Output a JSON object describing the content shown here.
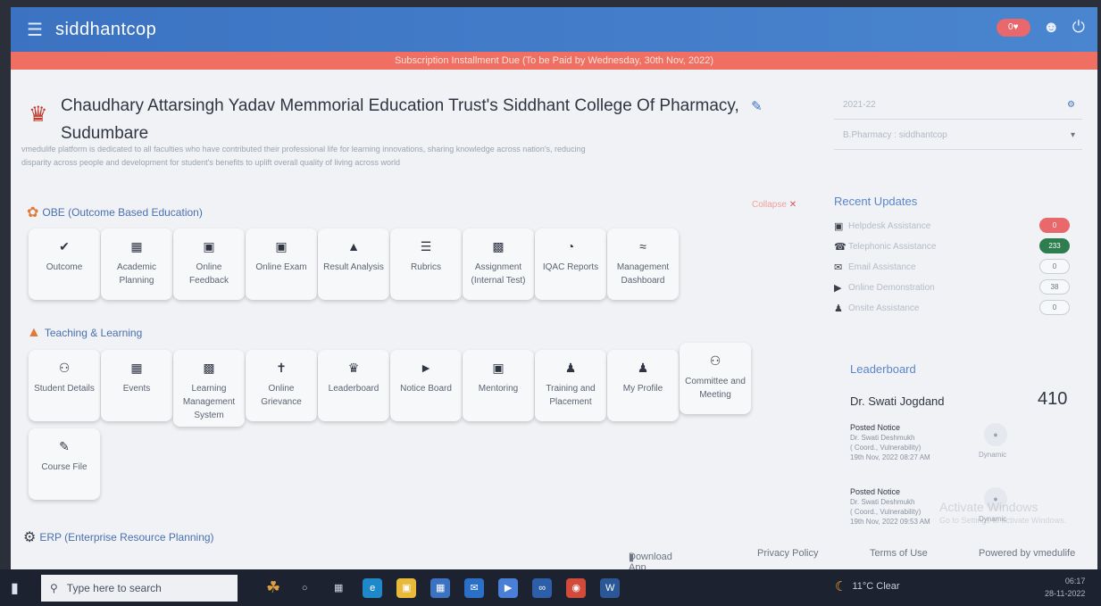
{
  "header": {
    "brand": "siddhantcop",
    "menu_icon": "hamburger-icon",
    "notification_count": "0",
    "banner": "Subscription Installment Due (To be Paid by Wednesday, 30th Nov, 2022)"
  },
  "college": {
    "name_line1": "Chaudhary Attarsingh Yadav Memmorial Education Trust's Siddhant College Of Pharmacy,",
    "name_line2": "Sudumbare",
    "description_line1": "vmedulife platform is dedicated to all faculties who have contributed their professional life for learning innovations, sharing knowledge across nation's, reducing",
    "description_line2": "disparity across people and development for student's benefits to uplift overall quality of living across world"
  },
  "selectors": {
    "year": "2021-22",
    "program": "B.Pharmacy : siddhantcop"
  },
  "obe": {
    "title": "OBE (Outcome Based Education)",
    "collapse_label": "Collapse",
    "tiles": [
      {
        "icon": "thumbs-up-icon",
        "label": "Outcome"
      },
      {
        "icon": "calendar-icon",
        "label": "Academic Planning"
      },
      {
        "icon": "comment-icon",
        "label": "Online Feedback"
      },
      {
        "icon": "folder-icon",
        "label": "Online Exam"
      },
      {
        "icon": "area-chart-icon",
        "label": "Result Analysis"
      },
      {
        "icon": "list-icon",
        "label": "Rubrics"
      },
      {
        "icon": "book-icon",
        "label": "Assignment (Internal Test)"
      },
      {
        "icon": "pie-chart-icon",
        "label": "IQAC Reports"
      },
      {
        "icon": "line-chart-icon",
        "label": "Management Dashboard"
      }
    ]
  },
  "teaching": {
    "title": "Teaching & Learning",
    "tiles": [
      {
        "icon": "users-icon",
        "label": "Student Details"
      },
      {
        "icon": "calendar-icon",
        "label": "Events"
      },
      {
        "icon": "book-icon",
        "label": "Learning Management System"
      },
      {
        "icon": "person-icon",
        "label": "Online Grievance"
      },
      {
        "icon": "trophy-icon",
        "label": "Leaderboard"
      },
      {
        "icon": "megaphone-icon",
        "label": "Notice Board"
      },
      {
        "icon": "presentation-icon",
        "label": "Mentoring"
      },
      {
        "icon": "user-tie-icon",
        "label": "Training and Placement"
      },
      {
        "icon": "user-icon",
        "label": "My Profile"
      },
      {
        "icon": "group-icon",
        "label": "Committee and Meeting"
      },
      {
        "icon": "file-icon",
        "label": "Course File"
      }
    ]
  },
  "erp": {
    "title": "ERP (Enterprise Resource Planning)"
  },
  "recent_updates": {
    "title": "Recent Updates",
    "items": [
      {
        "icon": "desktop-icon",
        "label": "Helpdesk Assistance",
        "count": "0",
        "color": "#e8686b"
      },
      {
        "icon": "phone-icon",
        "label": "Telephonic Assistance",
        "count": "233",
        "color": "#2e7d4f"
      },
      {
        "icon": "envelope-icon",
        "label": "Email Assistance",
        "count": "0",
        "color": ""
      },
      {
        "icon": "video-icon",
        "label": "Online Demonstration",
        "count": "38",
        "color": ""
      },
      {
        "icon": "user-onsite-icon",
        "label": "Onsite Assistance",
        "count": "0",
        "color": ""
      }
    ]
  },
  "leaderboard": {
    "title": "Leaderboard",
    "top_name": "Dr. Swati Jogdand",
    "top_score": "410",
    "notices": [
      {
        "title": "Posted Notice",
        "author": "Dr. Swati Deshmukh",
        "sub": "( Coord., Vulnerability)",
        "date": "19th Nov, 2022 08:27 AM",
        "tag": "Dynamic"
      },
      {
        "title": "Posted Notice",
        "author": "Dr. Swati Deshmukh",
        "sub": "( Coord., Vulnerability)",
        "date": "19th Nov, 2022 09:53 AM",
        "tag": "Dynamic"
      }
    ]
  },
  "overlay": {
    "watermark": "Activate Windows",
    "watermark_sub": "Go to Settings to activate Windows."
  },
  "footer": {
    "download": "Download App",
    "privacy": "Privacy Policy",
    "terms": "Terms of Use",
    "powered": "Powered by vmedulife"
  },
  "taskbar": {
    "search_placeholder": "Type here to search",
    "weather": "11°C Clear",
    "time": "06:17",
    "date": "28-11-2022"
  }
}
